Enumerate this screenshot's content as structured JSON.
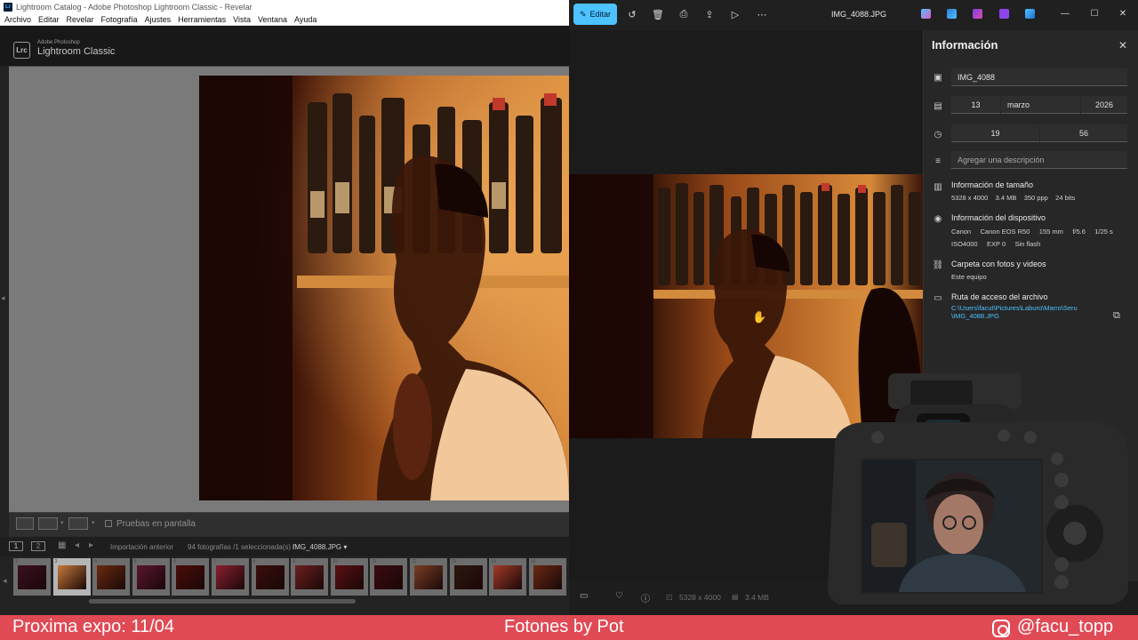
{
  "lightroom": {
    "window_title": "Lightroom Catalog - Adobe Photoshop Lightroom Classic - Revelar",
    "app_icon_text": "Lr",
    "menu": [
      "Archivo",
      "Editar",
      "Revelar",
      "Fotografía",
      "Ajustes",
      "Herramientas",
      "Vista",
      "Ventana",
      "Ayuda"
    ],
    "logo_text": "Lrc",
    "brand_sub": "Adobe Photoshop",
    "brand_name": "Lightroom Classic",
    "proof_label": "Pruebas en pantalla",
    "filmnav": {
      "page1": "1",
      "page2": "2",
      "source": "Importación anterior",
      "count": "94 fotografías /1 seleccionada(s) /",
      "filename": "IMG_4088.JPG ▾"
    },
    "thumbnails": [
      "2",
      "3",
      "4",
      "5",
      "6",
      "7",
      "8",
      "9",
      "10",
      "11",
      "12",
      "13",
      "14",
      "15"
    ]
  },
  "photos": {
    "edit_label": "Editar",
    "filename": "IMG_4088.JPG",
    "info": {
      "title": "Información",
      "name": "IMG_4088",
      "date_day": "13",
      "date_month": "marzo",
      "date_year": "2026",
      "time_hour": "19",
      "time_minute": "56",
      "description_placeholder": "Agregar una descripción",
      "size_title": "Información de tamaño",
      "size_details": "5328 x 4000    3.4 MB    350 ppp    24 bits",
      "device_title": "Información del dispositivo",
      "device_line1": "Canon     Canon EOS R50     155 mm     f/5.6     1/25 s",
      "device_line2": "ISO4000     EXP 0     Sin flash",
      "folder_title": "Carpeta con fotos y videos",
      "folder_value": "Este equipo",
      "path_title": "Ruta de acceso del archivo",
      "path_line1": "C:\\Users\\facut\\Pictures\\Laburo\\Marro\\Seru",
      "path_line2": "\\IMG_4088.JPG"
    },
    "bottombar": {
      "dimensions": "5328 x 4000",
      "filesize": "3.4 MB"
    }
  },
  "banner": {
    "left": "Proxima expo: 11/04",
    "center": "Fotones by Pot",
    "right": "@facu_topp"
  },
  "colors": {
    "accent": "#4cc2ff",
    "banner": "#e04a55"
  }
}
